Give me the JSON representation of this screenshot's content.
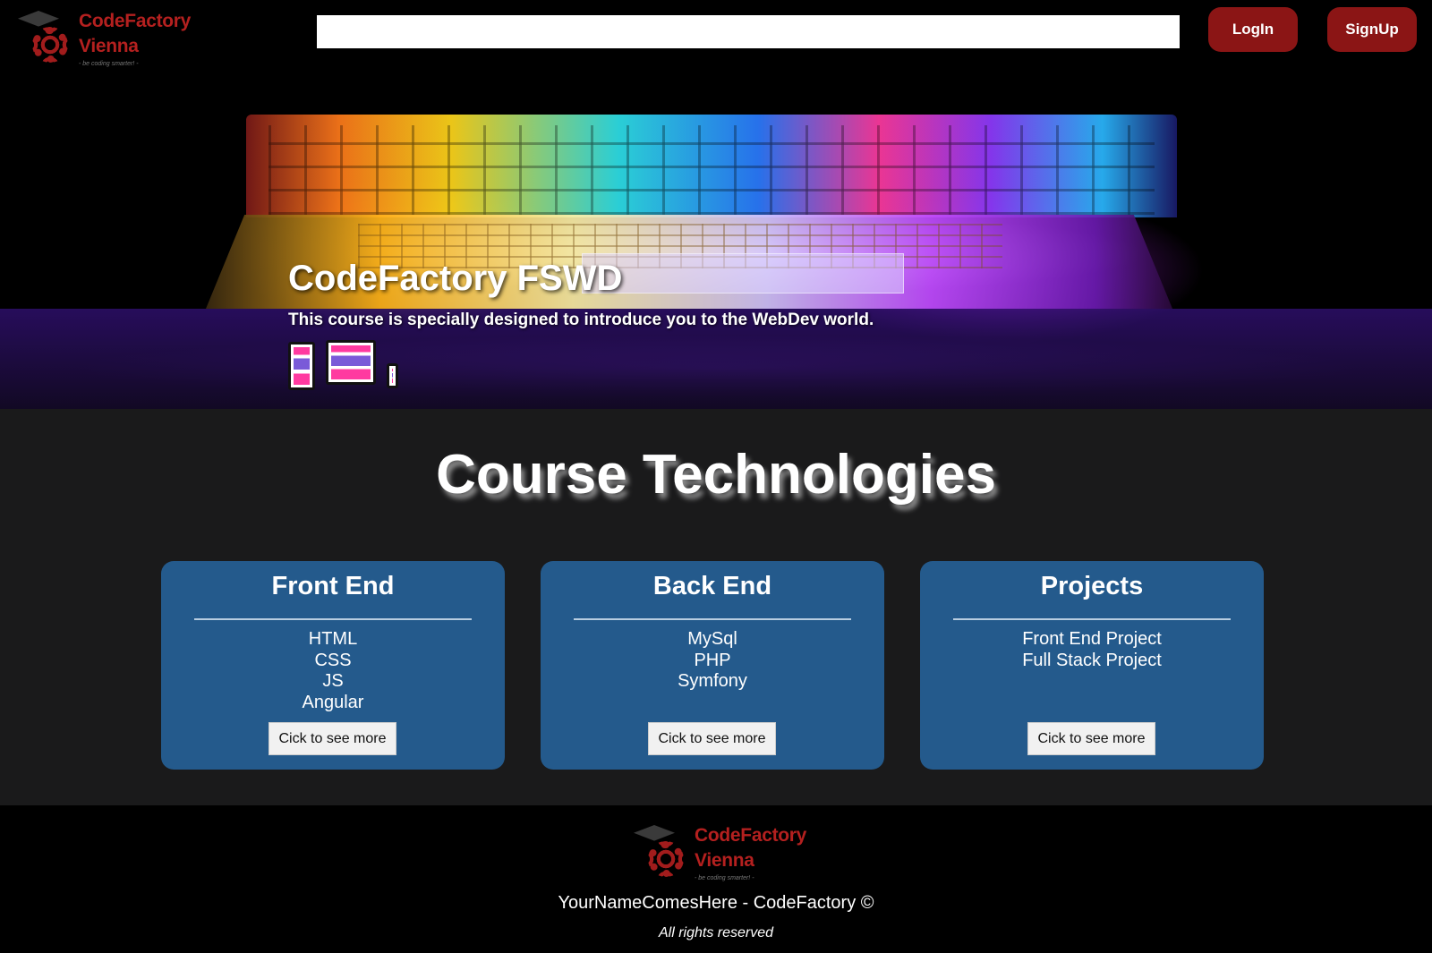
{
  "header": {
    "logo": {
      "line1": "CodeFactory",
      "line2": "Vienna",
      "tagline": "- be coding smarter! -"
    },
    "search": {
      "value": "",
      "placeholder": ""
    },
    "login_label": "LogIn",
    "signup_label": "SignUp"
  },
  "hero": {
    "title": "CodeFactory FSWD",
    "subtitle": "This course is specially designed to introduce you to the WebDev world.",
    "device_icons": [
      "tablet-icon",
      "desktop-icon",
      "phone-icon"
    ]
  },
  "main": {
    "section_title": "Course Technologies",
    "cards": [
      {
        "title": "Front End",
        "items": [
          "HTML",
          "CSS",
          "JS",
          "Angular"
        ],
        "button": "Cick to see more"
      },
      {
        "title": "Back End",
        "items": [
          "MySql",
          "PHP",
          "Symfony"
        ],
        "button": "Cick to see more"
      },
      {
        "title": "Projects",
        "items": [
          "Front End Project",
          "Full Stack Project"
        ],
        "button": "Cick to see more"
      }
    ]
  },
  "footer": {
    "logo": {
      "line1": "CodeFactory",
      "line2": "Vienna",
      "tagline": "- be coding smarter! -"
    },
    "copyright": "YourNameComesHere - CodeFactory ©",
    "rights": "All rights reserved"
  },
  "colors": {
    "background": "#1a1a1b",
    "accent_red": "#8b1515",
    "logo_red": "#b4201f",
    "card_blue": "#245a8c",
    "footer": "#000000"
  }
}
